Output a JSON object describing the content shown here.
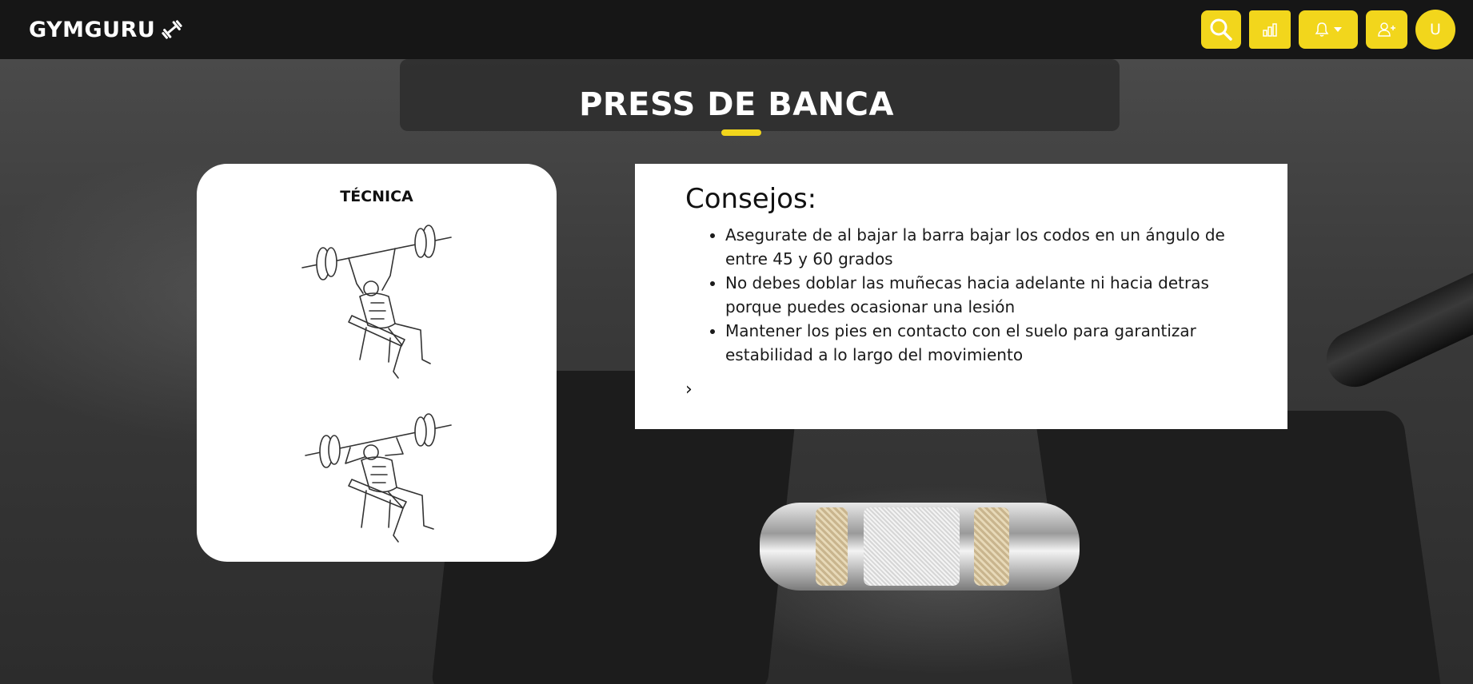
{
  "navbar": {
    "brand": "GYMGURU",
    "icons": [
      "dumbbell-icon",
      "search-icon",
      "bar-chart-icon",
      "bell-icon",
      "add-user-icon"
    ],
    "avatar_initial": "U",
    "accent_color": "#f2d61c",
    "background_color": "#161616"
  },
  "page": {
    "title": "PRESS DE BANCA"
  },
  "technique": {
    "title": "TÉCNICA"
  },
  "tips": {
    "title": "Consejos:",
    "items": [
      "Asegurate de al bajar la barra bajar los codos en un ángulo de entre 45 y 60 grados",
      "No debes doblar las muñecas hacia adelante ni hacia detras porque puedes ocasionar una lesión",
      "Mantener los pies en contacto con el suelo para garantizar estabilidad a lo largo del movimiento"
    ],
    "more": "›"
  }
}
